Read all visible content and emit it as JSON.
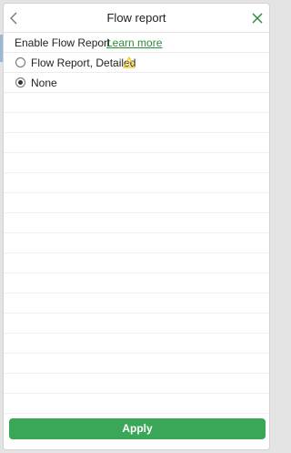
{
  "dialog": {
    "title": "Flow report",
    "back_icon": "chevron-left-icon",
    "close_icon": "close-x-icon",
    "accent_color": "#2e8b3a"
  },
  "setting": {
    "label": "Enable Flow Report",
    "learn_more": "Learn more"
  },
  "options": [
    {
      "label": "Flow Report, Detailed",
      "selected": false,
      "icon": "warning-icon",
      "icon_color": "#f2c200"
    },
    {
      "label": "None",
      "selected": true
    }
  ],
  "footer": {
    "apply_label": "Apply",
    "apply_color": "#3aa658"
  }
}
